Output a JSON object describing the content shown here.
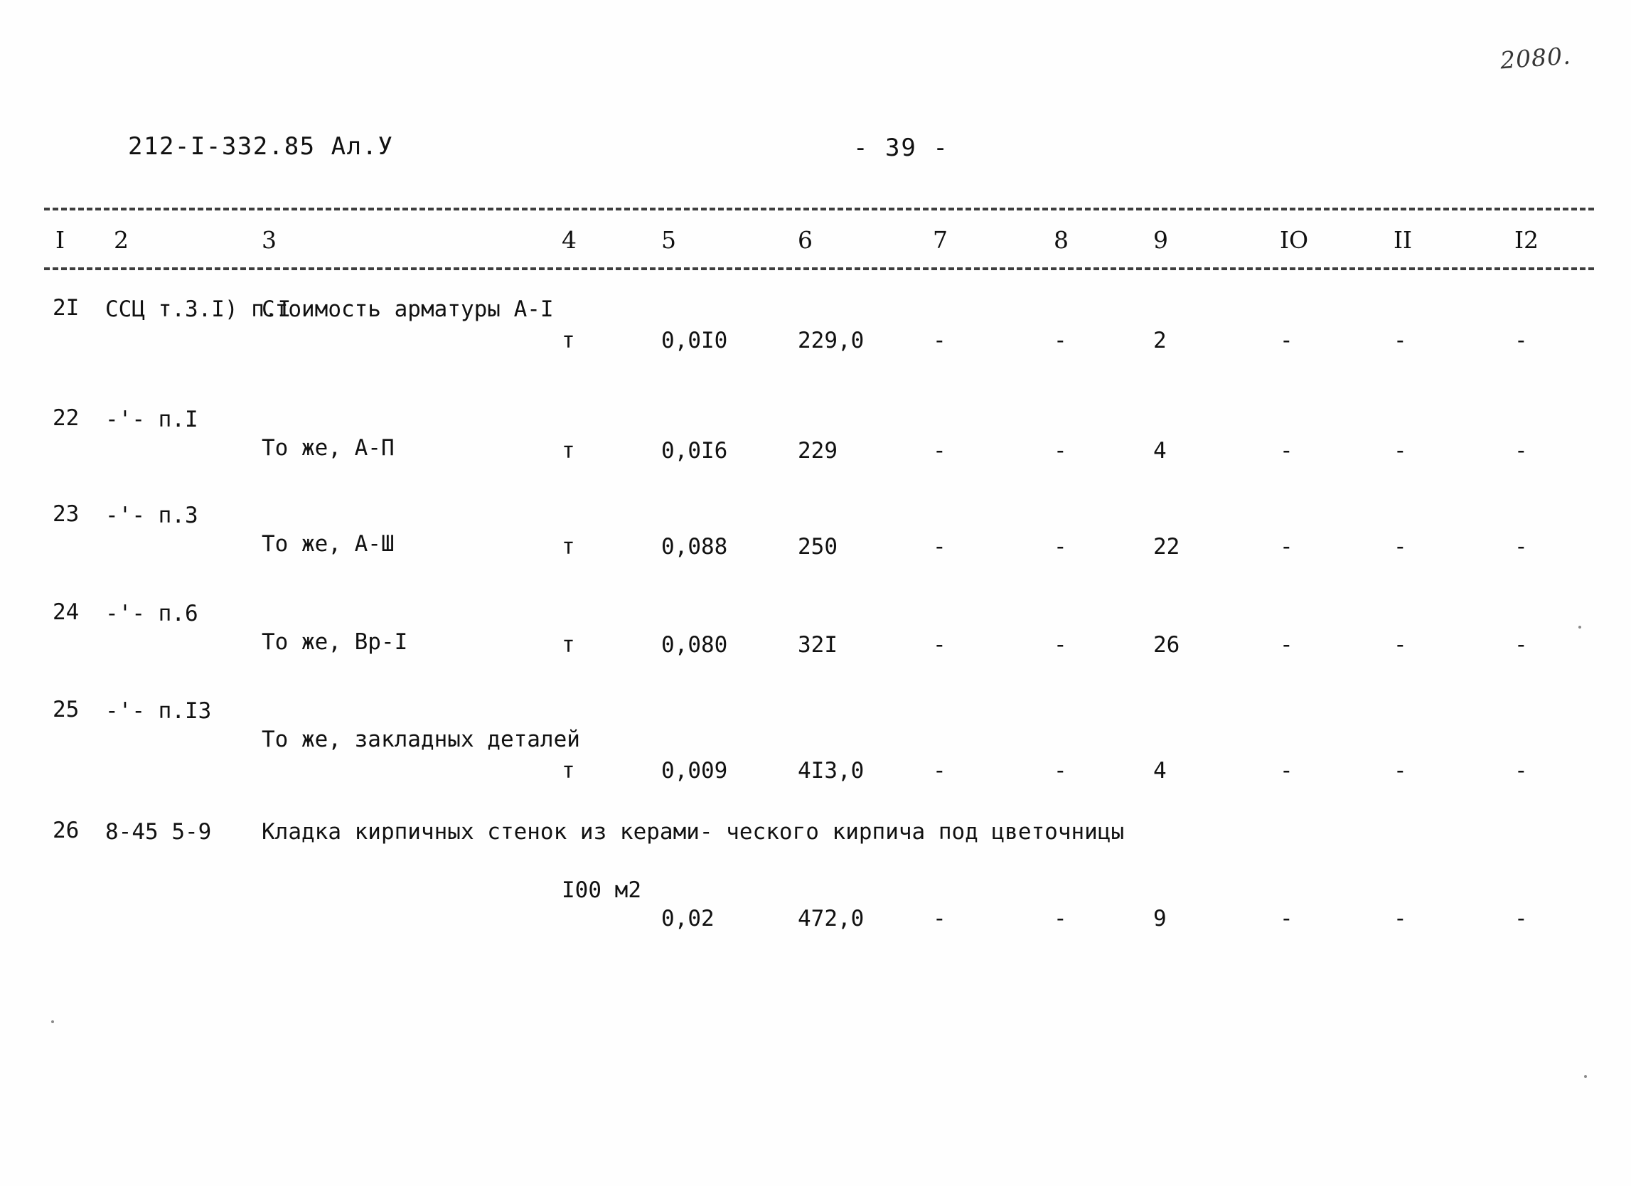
{
  "header": {
    "hand_note": "2080.",
    "doc_code": "212-I-332.85 Ал.У",
    "page_number": "- 39 -"
  },
  "table": {
    "column_numbers": [
      "I",
      "2",
      "3",
      "4",
      "5",
      "6",
      "7",
      "8",
      "9",
      "IO",
      "II",
      "I2"
    ],
    "rows": [
      {
        "num": "2I",
        "code": "ССЦ\nт.3.I)\nп.I",
        "desc": "Стоимость арматуры\nА-I",
        "unit": "т",
        "c5": "0,0I0",
        "c6": "229,0",
        "c7": "-",
        "c8": "-",
        "c9": "2",
        "c10": "-",
        "c11": "-",
        "c12": "-"
      },
      {
        "num": "22",
        "code": "-'-\nп.I",
        "desc": "То же, А-П",
        "unit": "т",
        "c5": "0,0I6",
        "c6": "229",
        "c7": "-",
        "c8": "-",
        "c9": "4",
        "c10": "-",
        "c11": "-",
        "c12": "-"
      },
      {
        "num": "23",
        "code": "-'-\nп.3",
        "desc": "То же, А-Ш",
        "unit": "т",
        "c5": "0,088",
        "c6": "250",
        "c7": "-",
        "c8": "-",
        "c9": "22",
        "c10": "-",
        "c11": "-",
        "c12": "-"
      },
      {
        "num": "24",
        "code": "-'-\nп.6",
        "desc": "То же, Вр-I",
        "unit": "т",
        "c5": "0,080",
        "c6": "32I",
        "c7": "-",
        "c8": "-",
        "c9": "26",
        "c10": "-",
        "c11": "-",
        "c12": "-"
      },
      {
        "num": "25",
        "code": "-'-\nп.I3",
        "desc": "То же, закладных\nдеталей",
        "unit": "т",
        "c5": "0,009",
        "c6": "4I3,0",
        "c7": "-",
        "c8": "-",
        "c9": "4",
        "c10": "-",
        "c11": "-",
        "c12": "-"
      },
      {
        "num": "26",
        "code": "8-45\n5-9",
        "desc": "Кладка кирпичных\nстенок из керами-\nческого кирпича\nпод цветочницы",
        "unit": "I00\nм2",
        "c5": "0,02",
        "c6": "472,0",
        "c7": "-",
        "c8": "-",
        "c9": "9",
        "c10": "-",
        "c11": "-",
        "c12": "-"
      }
    ]
  }
}
